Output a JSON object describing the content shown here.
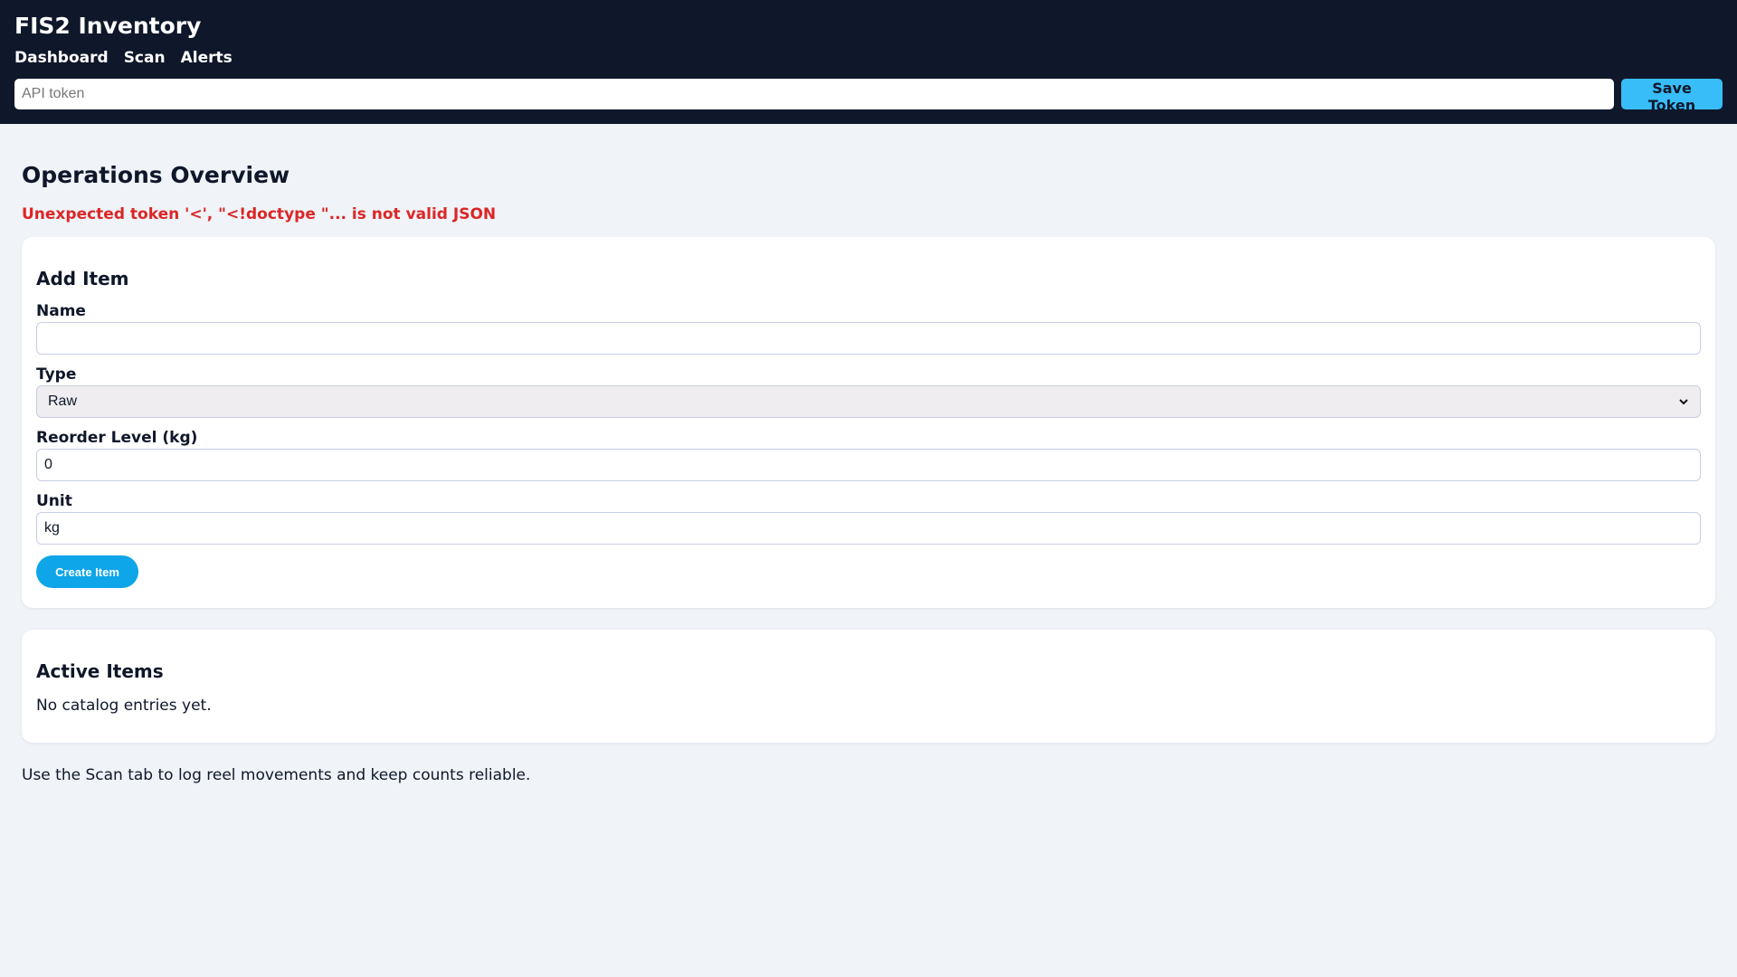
{
  "app": {
    "title": "FIS2 Inventory"
  },
  "nav": {
    "dashboard": "Dashboard",
    "scan": "Scan",
    "alerts": "Alerts"
  },
  "token": {
    "placeholder": "API token",
    "value": "",
    "save_label": "Save Token"
  },
  "main": {
    "page_title": "Operations Overview",
    "error": "Unexpected token '<', \"<!doctype \"... is not valid JSON"
  },
  "add_item": {
    "title": "Add Item",
    "name_label": "Name",
    "name_value": "",
    "type_label": "Type",
    "type_value": "Raw",
    "reorder_label": "Reorder Level (kg)",
    "reorder_value": "0",
    "unit_label": "Unit",
    "unit_value": "kg",
    "create_label": "Create Item"
  },
  "active_items": {
    "title": "Active Items",
    "empty_text": "No catalog entries yet."
  },
  "footer": {
    "note": "Use the Scan tab to log reel movements and keep counts reliable."
  },
  "colors": {
    "header_bg": "#0f172a",
    "page_bg": "#f0f3f8",
    "accent": "#38bdf8",
    "primary_button": "#0ea5e9",
    "error": "#dc2626"
  }
}
